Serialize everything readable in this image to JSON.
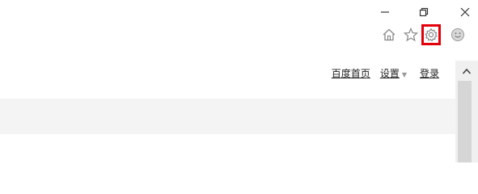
{
  "window_controls": {
    "minimize_icon": "minimize-icon",
    "restore_icon": "restore-icon",
    "close_icon": "close-icon"
  },
  "toolbar": {
    "home_icon": "home-icon",
    "favorites_icon": "star-icon",
    "tools_icon": "gear-icon",
    "feedback_icon": "smiley-icon",
    "highlight_color": "#e3000b"
  },
  "top_links": {
    "home_page": "百度首页",
    "settings": "设置",
    "login": "登录"
  }
}
